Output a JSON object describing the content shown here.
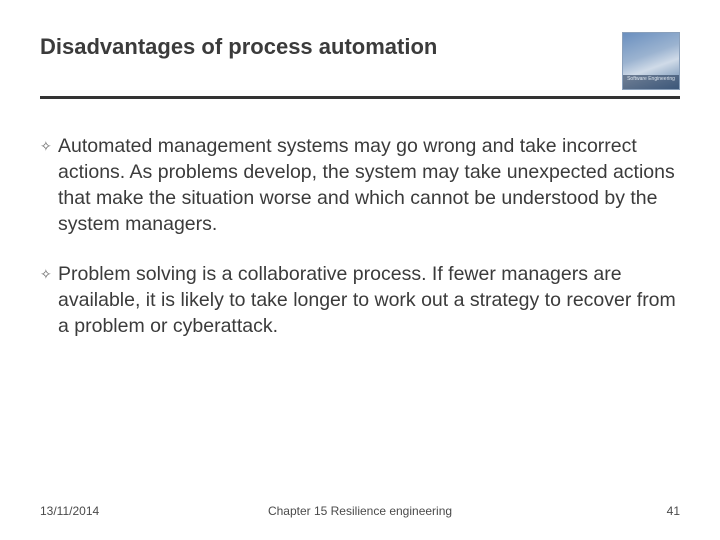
{
  "header": {
    "title": "Disadvantages of process automation",
    "logo": {
      "caption_line1": "Software Engineering",
      "caption_line2": ""
    }
  },
  "bullets": [
    "Automated management systems may go wrong and take incorrect actions. As problems develop, the system may take unexpected actions that make the situation worse and which cannot be understood by the system managers.",
    "Problem solving is a collaborative process. If fewer managers are available, it is likely to take longer to work out a strategy to recover from a problem or cyberattack."
  ],
  "footer": {
    "date": "13/11/2014",
    "chapter": "Chapter 15 Resilience engineering",
    "page": "41"
  }
}
